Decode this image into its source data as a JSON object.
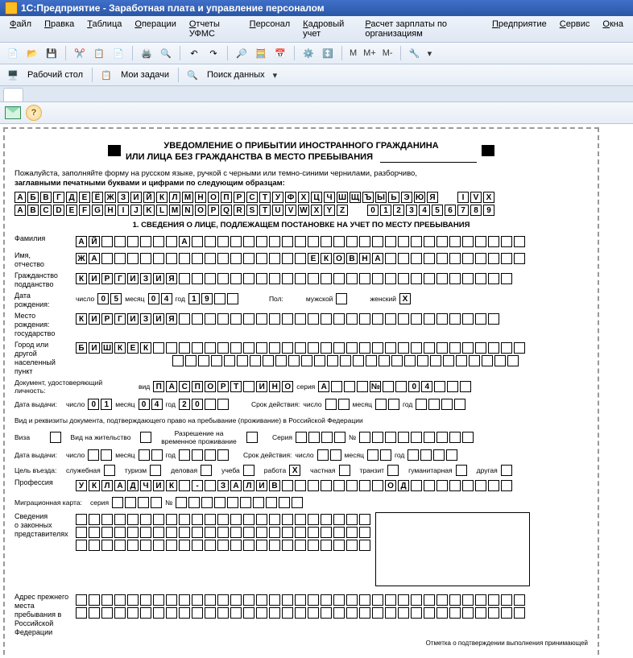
{
  "window": {
    "title": "1С:Предприятие - Заработная плата и управление персоналом"
  },
  "menu": [
    "Файл",
    "Правка",
    "Таблица",
    "Операции",
    "Отчеты УФМС",
    "Персонал",
    "Кадровый учет",
    "Расчет зарплаты по организациям",
    "Предприятие",
    "Сервис",
    "Окна"
  ],
  "toolbar2": {
    "desktop": "Рабочий стол",
    "tasks": "Мои задачи",
    "search": "Поиск данных"
  },
  "mbuttons": [
    "M",
    "M+",
    "M-"
  ],
  "form": {
    "title1": "УВЕДОМЛЕНИЕ О ПРИБЫТИИ ИНОСТРАННОГО ГРАЖДАНИНА",
    "title2": "ИЛИ ЛИЦА БЕЗ ГРАЖДАНСТВА В МЕСТО ПРЕБЫВАНИЯ",
    "instr1": "Пожалуйста, заполняйте форму на русском языке, ручкой с черными или темно-синими чернилами, разборчиво,",
    "instr2": "заглавными печатными буквами и цифрами по следующим образцам:",
    "sample_ru": [
      "А",
      "Б",
      "В",
      "Г",
      "Д",
      "Е",
      "Ё",
      "Ж",
      "З",
      "И",
      "Й",
      "К",
      "Л",
      "М",
      "Н",
      "О",
      "П",
      "Р",
      "С",
      "Т",
      "У",
      "Ф",
      "Х",
      "Ц",
      "Ч",
      "Ш",
      "Щ",
      "Ъ",
      "Ы",
      "Ь",
      "Э",
      "Ю",
      "Я"
    ],
    "sample_roman": [
      "I",
      "V",
      "X"
    ],
    "sample_en": [
      "A",
      "B",
      "C",
      "D",
      "E",
      "F",
      "G",
      "H",
      "I",
      "J",
      "K",
      "L",
      "M",
      "N",
      "O",
      "P",
      "Q",
      "R",
      "S",
      "T",
      "U",
      "V",
      "W",
      "X",
      "Y",
      "Z"
    ],
    "sample_num": [
      "0",
      "1",
      "2",
      "3",
      "4",
      "5",
      "6",
      "7",
      "8",
      "9"
    ],
    "section1": "1. СВЕДЕНИЯ О ЛИЦЕ, ПОДЛЕЖАЩЕМ ПОСТАНОВКЕ НА УЧЕТ ПО МЕСТУ ПРЕБЫВАНИЯ",
    "l_surname": "Фамилия",
    "surname": [
      "А",
      "Й",
      "",
      "",
      "",
      "",
      "",
      "",
      "А"
    ],
    "l_name": "Имя,\nотчество",
    "name": [
      "Ж",
      "А",
      "",
      "",
      "",
      "",
      "",
      "",
      "",
      "",
      "",
      "",
      "",
      "",
      "",
      "",
      "",
      "",
      "Е",
      "К",
      "О",
      "В",
      "Н",
      "А"
    ],
    "l_citizen": "Гражданство\nподданство",
    "citizen": [
      "К",
      "И",
      "Р",
      "Г",
      "И",
      "З",
      "И",
      "Я"
    ],
    "l_dob": "Дата\nрождения:",
    "l_day": "число",
    "dob_d": [
      "0",
      "5"
    ],
    "l_month": "месяц",
    "dob_m": [
      "0",
      "4"
    ],
    "l_year": "год",
    "dob_y": [
      "1",
      "9",
      "",
      ""
    ],
    "l_sex": "Пол:",
    "l_male": "мужской",
    "l_female": "женский",
    "sex_f": "X",
    "l_birthplace": "Место рождения:\nгосударство",
    "birthplace": [
      "К",
      "И",
      "Р",
      "Г",
      "И",
      "З",
      "И",
      "Я"
    ],
    "l_city": "Город или другой\nнаселенный пункт",
    "city": [
      "Б",
      "И",
      "Ш",
      "К",
      "Е",
      "К"
    ],
    "l_doc": "Документ, удостоверяющий личность:",
    "l_kind": "вид",
    "doc_kind": [
      "П",
      "А",
      "С",
      "П",
      "О",
      "Р",
      "Т",
      "",
      "И",
      "Н",
      "О"
    ],
    "l_series": "серия",
    "doc_series": [
      "А",
      "",
      "",
      "",
      "№",
      "",
      "",
      "0",
      "4"
    ],
    "l_issue": "Дата выдачи:",
    "iss_d": [
      "0",
      "1"
    ],
    "iss_m": [
      "0",
      "4"
    ],
    "iss_y": [
      "2",
      "0",
      "",
      ""
    ],
    "l_valid": "Срок действия:",
    "val_d": [
      "",
      ""
    ],
    "val_m": [
      "",
      ""
    ],
    "val_y": [
      "",
      "",
      "",
      ""
    ],
    "l_rightdoc": "Вид и реквизиты документа, подтверждающего право на пребывание (проживание) в Российской Федерации",
    "l_visa": "Виза",
    "l_resperm": "Вид на жительство",
    "l_tempperm": "Разрешение на\nвременное проживание",
    "l_series2": "Серия",
    "l_no": "№",
    "l_issued2": "Дата выдачи:",
    "l_valid2": "Срок действия:",
    "l_purpose": "Цель въезда:",
    "purposes": [
      "служебная",
      "туризм",
      "деловая",
      "учеба",
      "работа",
      "частная",
      "транзит",
      "гуманитарная",
      "другая"
    ],
    "purpose_mark_index": 4,
    "purpose_mark": "X",
    "l_prof": "Профессия",
    "profession": [
      "У",
      "К",
      "Л",
      "А",
      "Д",
      "Ч",
      "И",
      "К",
      "",
      "-",
      "",
      "З",
      "А",
      "Л",
      "И",
      "В",
      "",
      "",
      "",
      "",
      "",
      "",
      "",
      "",
      "О",
      "Д"
    ],
    "l_migcard": "Миграционная карта:",
    "l_mc_series": "серия",
    "l_mc_no": "№",
    "l_legalrep": "Сведения\nо законных\nпредставителях",
    "l_prevaddr": "Адрес прежнего\nместа\nпребывания в\nРоссийской\nФедерации",
    "footnote": "Отметка о подтверждении выполнения принимающей"
  }
}
